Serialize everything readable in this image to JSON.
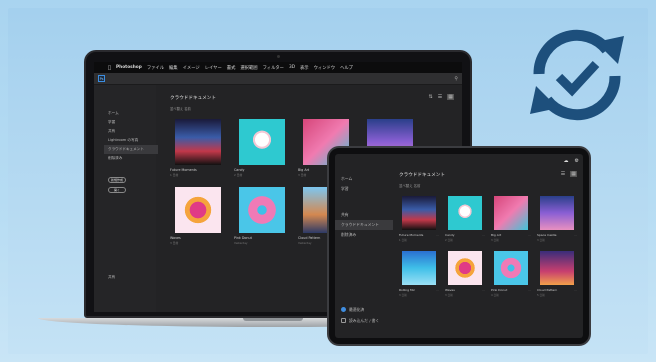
{
  "icons": {
    "sync": "sync-check-icon",
    "apple": "apple-logo-icon",
    "search": "search-icon"
  },
  "colors": {
    "accent": "#1d4f7c",
    "background": "#b0d8f2",
    "app_dark": "#232325",
    "ps_blue": "#3b8de0"
  },
  "laptop": {
    "menubar": {
      "app": "Photoshop",
      "items": [
        "ファイル",
        "編集",
        "イメージ",
        "レイヤー",
        "書式",
        "選択範囲",
        "フィルター",
        "3D",
        "表示",
        "ウィンドウ",
        "ヘルプ"
      ]
    },
    "ps_logo": "Ps",
    "sidebar": {
      "items": [
        "ホーム",
        "学習",
        "共有",
        "Lightroom の写真",
        "クラウドドキュメント",
        "削除済み"
      ],
      "buttons": [
        "新規作成",
        "開く"
      ],
      "bottom": "共有"
    },
    "main": {
      "title": "クラウドドキュメント",
      "sort": "並べ替え  名前",
      "files": [
        {
          "name": "Future Moments",
          "meta": "1 日前"
        },
        {
          "name": "Candy",
          "meta": "2 日前"
        },
        {
          "name": "Big Art",
          "meta": "3 日前"
        },
        {
          "name": "",
          "meta": ""
        },
        {
          "name": "Waves",
          "meta": "3 日前"
        },
        {
          "name": "Pink Donut",
          "meta": "Yesterday"
        },
        {
          "name": "Cloud Pattern",
          "meta": "Yesterday"
        },
        {
          "name": "",
          "meta": ""
        }
      ]
    }
  },
  "tablet": {
    "sidebar": {
      "items": [
        "ホーム",
        "学習",
        "共有",
        "クラウドドキュメント",
        "削除済み"
      ],
      "checks": [
        "最適化済",
        "読み込んだ / 書く"
      ]
    },
    "main": {
      "title": "クラウドドキュメント",
      "sort": "並べ替え 名前",
      "files": [
        {
          "name": "Future Moments",
          "meta": "1 日前"
        },
        {
          "name": "Candy",
          "meta": "2 日前"
        },
        {
          "name": "Big Art",
          "meta": "3 日前"
        },
        {
          "name": "Space Castle",
          "meta": "3 日前"
        },
        {
          "name": "Rolling Mic",
          "meta": "3 日前"
        },
        {
          "name": "Waves",
          "meta": "3 日前"
        },
        {
          "name": "Pink Donut",
          "meta": "4 日前"
        },
        {
          "name": "Cloud Pattern",
          "meta": "5 日前"
        }
      ]
    }
  }
}
